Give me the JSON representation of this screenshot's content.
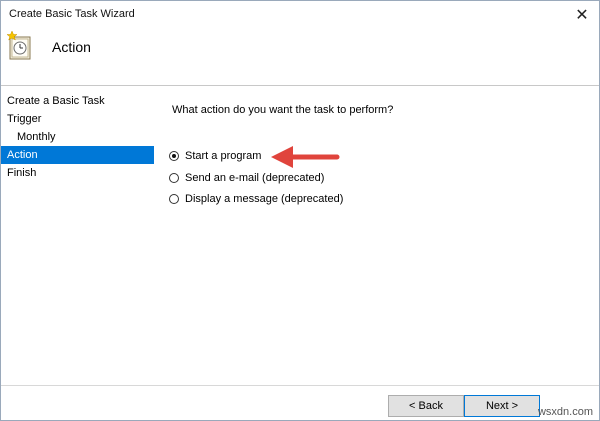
{
  "window": {
    "title": "Create Basic Task Wizard",
    "close_glyph": "✕"
  },
  "header": {
    "heading": "Action",
    "icon": "task-clock-icon"
  },
  "sidebar": {
    "items": [
      {
        "label": "Create a Basic Task"
      },
      {
        "label": "Trigger"
      },
      {
        "label": "Monthly"
      },
      {
        "label": "Action",
        "selected": true
      },
      {
        "label": "Finish"
      }
    ]
  },
  "main": {
    "question": "What action do you want the task to perform?",
    "options": [
      {
        "label": "Start a program",
        "checked": true
      },
      {
        "label": "Send an e-mail (deprecated)",
        "checked": false
      },
      {
        "label": "Display a message (deprecated)",
        "checked": false
      }
    ],
    "annotation_color": "#e0443c"
  },
  "footer": {
    "back_label": "< Back",
    "next_label": "Next >",
    "watermark": "wsxdn.com"
  },
  "colors": {
    "selection": "#0078d7",
    "arrow": "#e0443c"
  }
}
